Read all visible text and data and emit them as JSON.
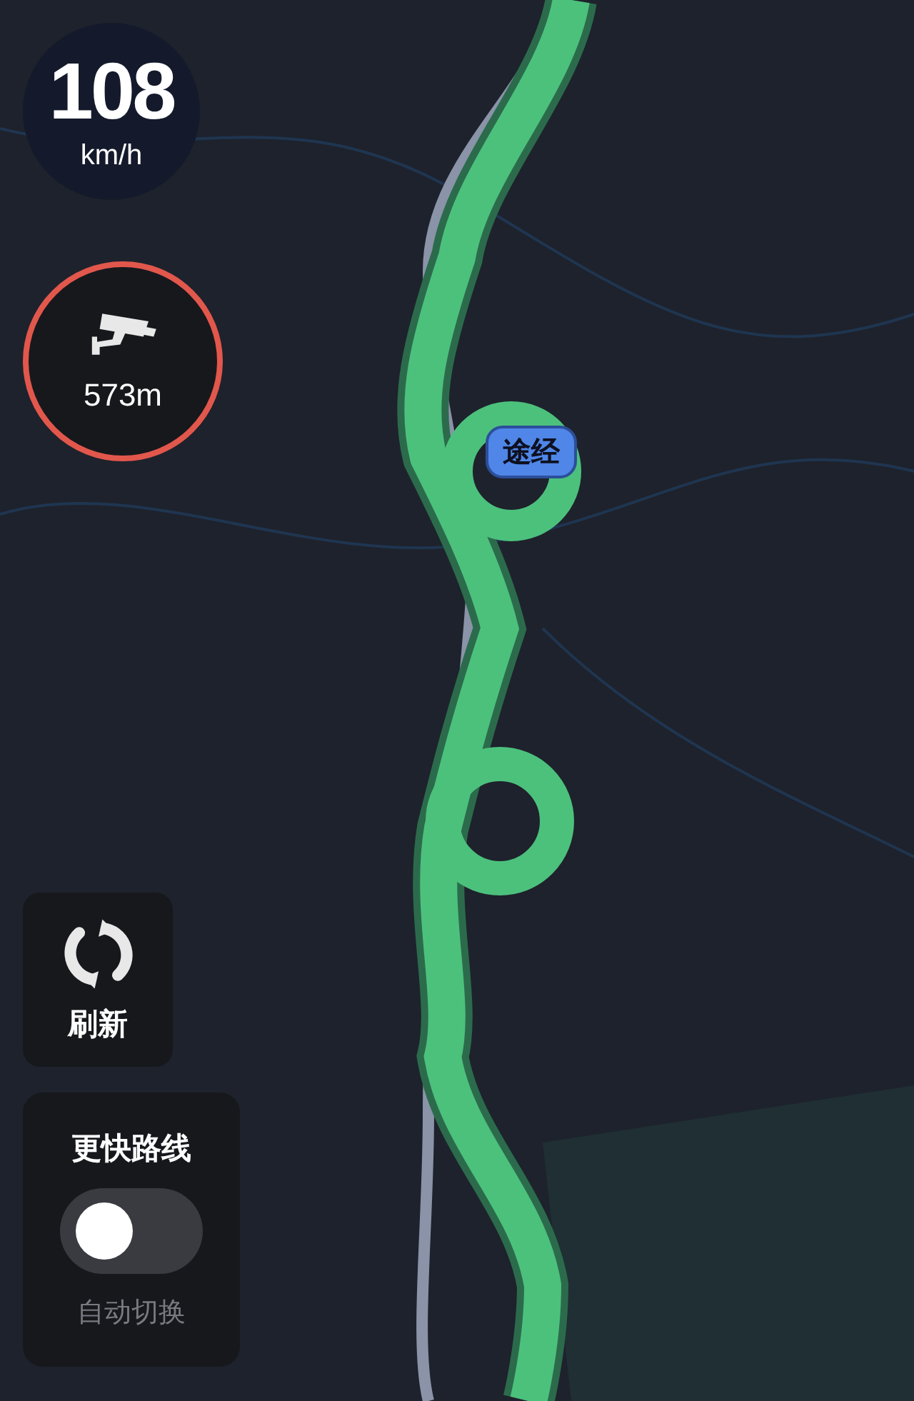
{
  "speed": {
    "value": "108",
    "unit": "km/h"
  },
  "camera": {
    "distance": "573m"
  },
  "waypoint": {
    "label": "途经"
  },
  "refresh": {
    "label": "刷新"
  },
  "faster_route": {
    "title": "更快路线",
    "on": false,
    "label": "自动切换"
  }
}
